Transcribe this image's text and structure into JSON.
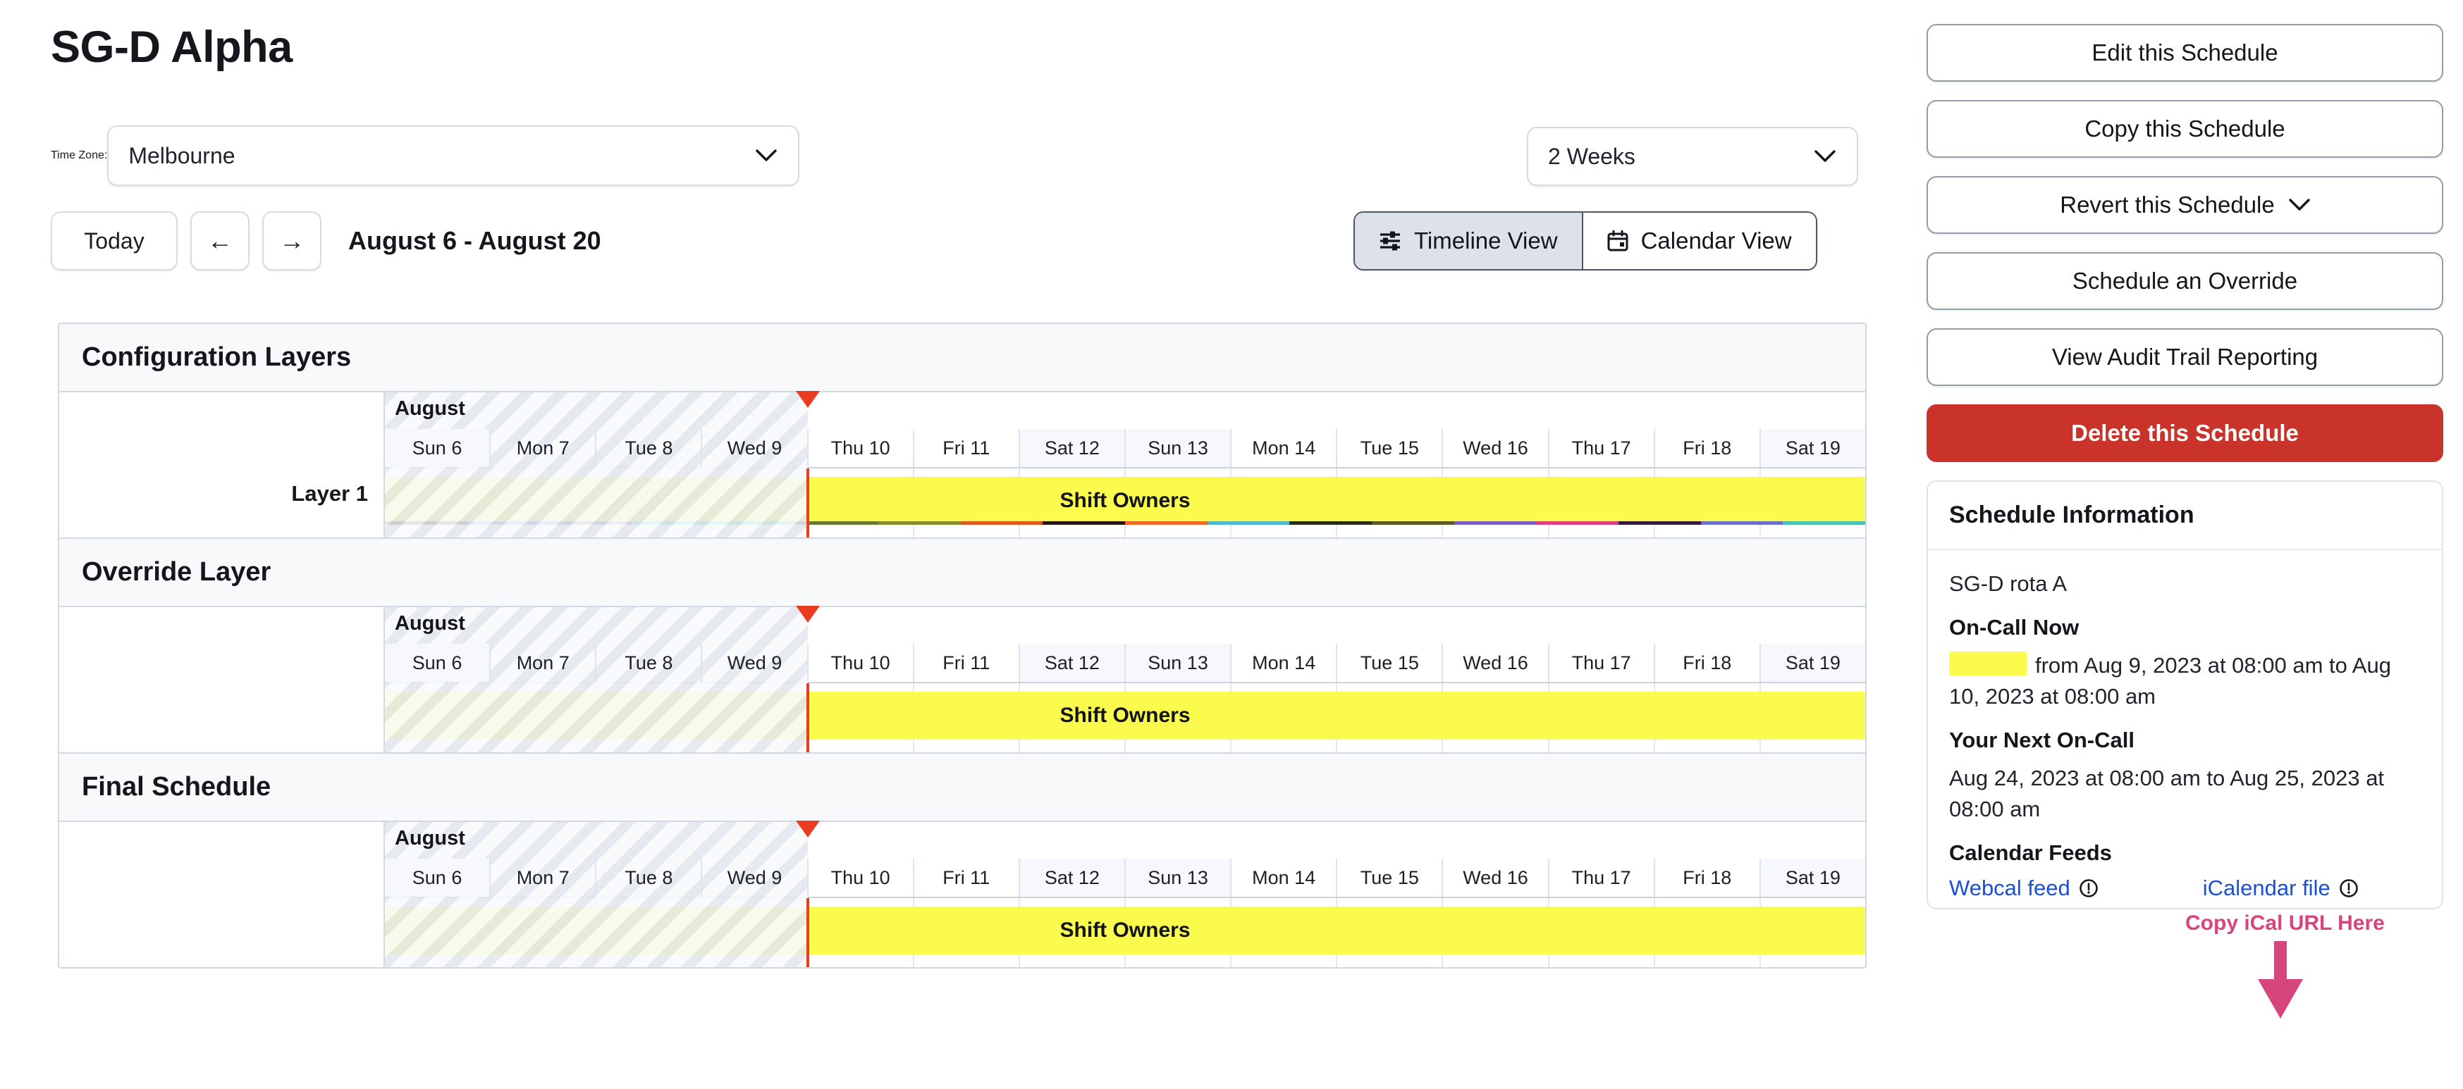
{
  "header": {
    "title": "SG-D Alpha",
    "timezone_label": "Time Zone:",
    "timezone_value": "Melbourne",
    "range_value": "2 Weeks",
    "today_label": "Today",
    "prev_label": "←",
    "next_label": "→",
    "date_range": "August 6 - August 20",
    "view_timeline": "Timeline View",
    "view_calendar": "Calendar View",
    "timeline_icon": "sliders-icon",
    "calendar_icon": "calendar-icon",
    "chevron_icon": "chevron-down-icon"
  },
  "timeline": {
    "month_label": "August",
    "days": [
      {
        "label": "Sun 6",
        "weekend": true,
        "past": true
      },
      {
        "label": "Mon 7",
        "weekend": false,
        "past": true
      },
      {
        "label": "Tue 8",
        "weekend": false,
        "past": true
      },
      {
        "label": "Wed 9",
        "weekend": false,
        "past": true
      },
      {
        "label": "Thu 10",
        "weekend": false,
        "past": false
      },
      {
        "label": "Fri 11",
        "weekend": false,
        "past": false
      },
      {
        "label": "Sat 12",
        "weekend": true,
        "past": false
      },
      {
        "label": "Sun 13",
        "weekend": true,
        "past": false
      },
      {
        "label": "Mon 14",
        "weekend": false,
        "past": false
      },
      {
        "label": "Tue 15",
        "weekend": false,
        "past": false
      },
      {
        "label": "Wed 16",
        "weekend": false,
        "past": false
      },
      {
        "label": "Thu 17",
        "weekend": false,
        "past": false
      },
      {
        "label": "Fri 18",
        "weekend": false,
        "past": false
      },
      {
        "label": "Sat 19",
        "weekend": true,
        "past": false
      }
    ],
    "now_marker_percent": 28.57,
    "shift_bar_label": "Shift Owners",
    "shift_bar_color": "#fafb4c",
    "now_marker_color": "#ea3c20",
    "sections": [
      {
        "title": "Configuration Layers",
        "row_label": "Layer 1",
        "has_stripe": true
      },
      {
        "title": "Override Layer",
        "row_label": "",
        "has_stripe": false
      },
      {
        "title": "Final Schedule",
        "row_label": "",
        "has_stripe": false
      }
    ],
    "stripe_colors": [
      "#5a3a2e",
      "#6f8fd0",
      "#7d6f9e",
      "#5fc9a8",
      "#58c2a0",
      "#6b7a33",
      "#8a8a2e",
      "#e05a20",
      "#2b1410",
      "#f06a2a",
      "#4fb9c9",
      "#2d2d15",
      "#5a5a22",
      "#7b5fc0",
      "#e0417f",
      "#3b1a3a",
      "#6f6fc8",
      "#49c2b0"
    ]
  },
  "sidebar": {
    "buttons": [
      {
        "label": "Edit this Schedule",
        "style": "default",
        "chevron": false
      },
      {
        "label": "Copy this Schedule",
        "style": "default",
        "chevron": false
      },
      {
        "label": "Revert this Schedule",
        "style": "default",
        "chevron": true
      },
      {
        "label": "Schedule an Override",
        "style": "default",
        "chevron": false
      },
      {
        "label": "View Audit Trail Reporting",
        "style": "default",
        "chevron": false
      },
      {
        "label": "Delete this Schedule",
        "style": "danger",
        "chevron": false
      }
    ],
    "info": {
      "heading": "Schedule Information",
      "rota_name": "SG-D rota A",
      "oncall_now_heading": "On-Call Now",
      "oncall_now_text": "from Aug 9, 2023 at 08:00 am to Aug 10, 2023 at 08:00 am",
      "next_oncall_heading": "Your Next On-Call",
      "next_oncall_text": "Aug 24, 2023 at 08:00 am to Aug 25, 2023 at 08:00 am",
      "calendar_feeds_heading": "Calendar Feeds",
      "webcal_link": "Webcal feed",
      "icalendar_link": "iCalendar file",
      "info_icon": "info-circle-icon"
    },
    "annotation": {
      "text": "Copy iCal URL Here",
      "color": "#d6457c",
      "arrow_icon": "down-arrow-annotation-icon"
    }
  }
}
